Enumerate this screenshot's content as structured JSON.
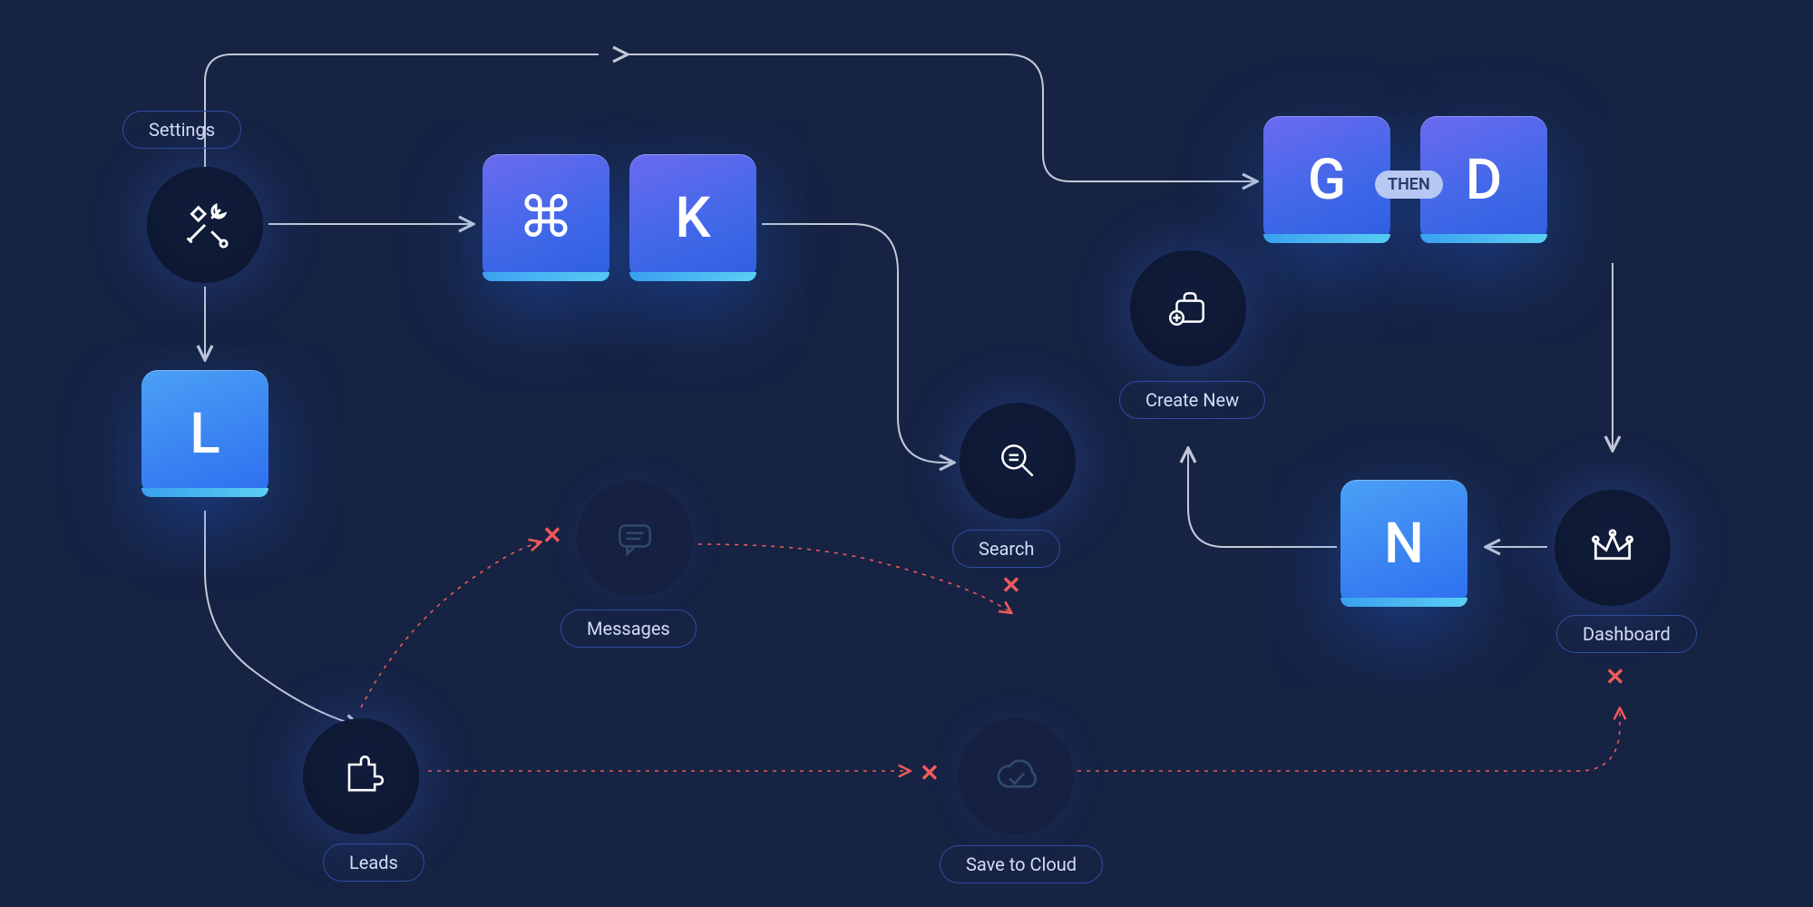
{
  "nodes": {
    "settings": {
      "label": "Settings"
    },
    "messages": {
      "label": "Messages"
    },
    "search": {
      "label": "Search"
    },
    "create_new": {
      "label": "Create New"
    },
    "dashboard": {
      "label": "Dashboard"
    },
    "leads": {
      "label": "Leads"
    },
    "save_to_cloud": {
      "label": "Save to Cloud"
    }
  },
  "keys": {
    "cmd": "⌘",
    "k": "K",
    "l": "L",
    "g": "G",
    "d": "D",
    "n": "N"
  },
  "then_badge": "THEN",
  "colors": {
    "bg": "#162343",
    "accent": "#3f68e8",
    "failed": "#ef5a5a",
    "line": "#c2c9d6"
  }
}
